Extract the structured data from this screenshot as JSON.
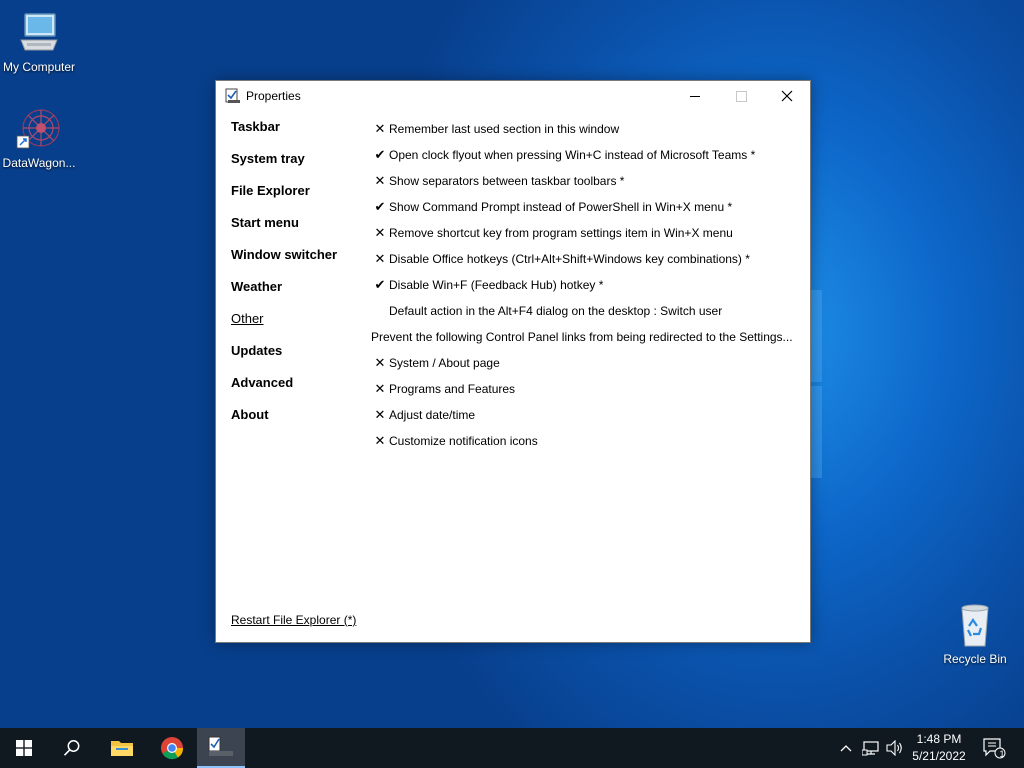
{
  "desktop": {
    "icons": [
      {
        "label": "My Computer"
      },
      {
        "label": "DataWagon..."
      },
      {
        "label": "Recycle Bin"
      }
    ]
  },
  "window": {
    "title": "Properties",
    "nav": [
      "Taskbar",
      "System tray",
      "File Explorer",
      "Start menu",
      "Window switcher",
      "Weather",
      "Other",
      "Updates",
      "Advanced",
      "About"
    ],
    "active_nav": "Other",
    "settings": [
      {
        "mark": "✕",
        "text": "Remember last used section in this window"
      },
      {
        "mark": "✔",
        "text": "Open clock flyout when pressing Win+C instead of Microsoft Teams *"
      },
      {
        "mark": "✕",
        "text": "Show separators between taskbar toolbars *"
      },
      {
        "mark": "✔",
        "text": "Show Command Prompt instead of PowerShell in Win+X menu *"
      },
      {
        "mark": "✕",
        "text": "Remove shortcut key from program settings item in Win+X menu"
      },
      {
        "mark": "✕",
        "text": "Disable Office hotkeys (Ctrl+Alt+Shift+Windows key combinations) *"
      },
      {
        "mark": "✔",
        "text": "Disable Win+F (Feedback Hub) hotkey *"
      },
      {
        "mark": "",
        "text": "Default action in the Alt+F4 dialog on the desktop : Switch user"
      },
      {
        "mark": null,
        "text": "Prevent the following Control Panel links from being redirected to the Settings..."
      },
      {
        "mark": "✕",
        "text": "System / About page"
      },
      {
        "mark": "✕",
        "text": "Programs and Features"
      },
      {
        "mark": "✕",
        "text": "Adjust date/time"
      },
      {
        "mark": "✕",
        "text": "Customize notification icons"
      }
    ],
    "restart_link": "Restart File Explorer (*)"
  },
  "taskbar": {
    "time": "1:48 PM",
    "date": "5/21/2022",
    "notification_count": "1"
  },
  "colors": {
    "taskbar_bg": "#101820",
    "desktop_accent": "#0d67c9"
  }
}
